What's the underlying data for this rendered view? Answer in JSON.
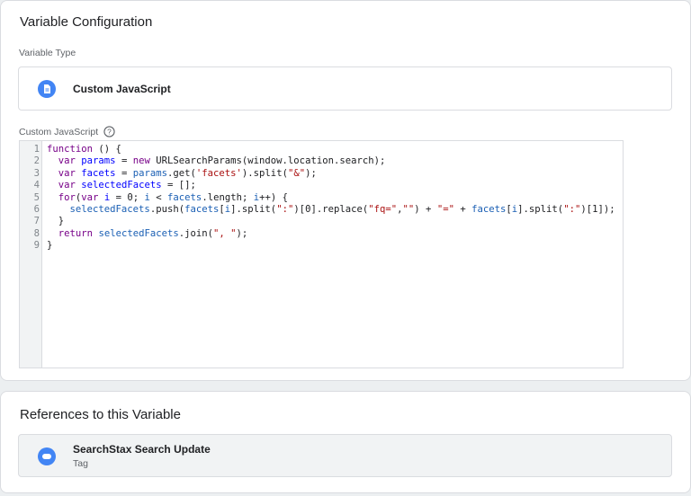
{
  "config": {
    "title": "Variable Configuration",
    "type_label": "Variable Type",
    "type_name": "Custom JavaScript",
    "type_icon": "document-icon",
    "code_label": "Custom JavaScript",
    "help_icon": "help-circle-icon"
  },
  "code_lines": [
    "1",
    "2",
    "3",
    "4",
    "5",
    "6",
    "7",
    "8",
    "9"
  ],
  "references": {
    "title": "References to this Variable",
    "items": [
      {
        "name": "SearchStax Search Update",
        "kind": "Tag",
        "icon": "tag-icon"
      }
    ]
  },
  "colors": {
    "accent": "#4285f4",
    "keyword": "#770088",
    "variable": "#1a5fb4",
    "string": "#aa1111"
  }
}
